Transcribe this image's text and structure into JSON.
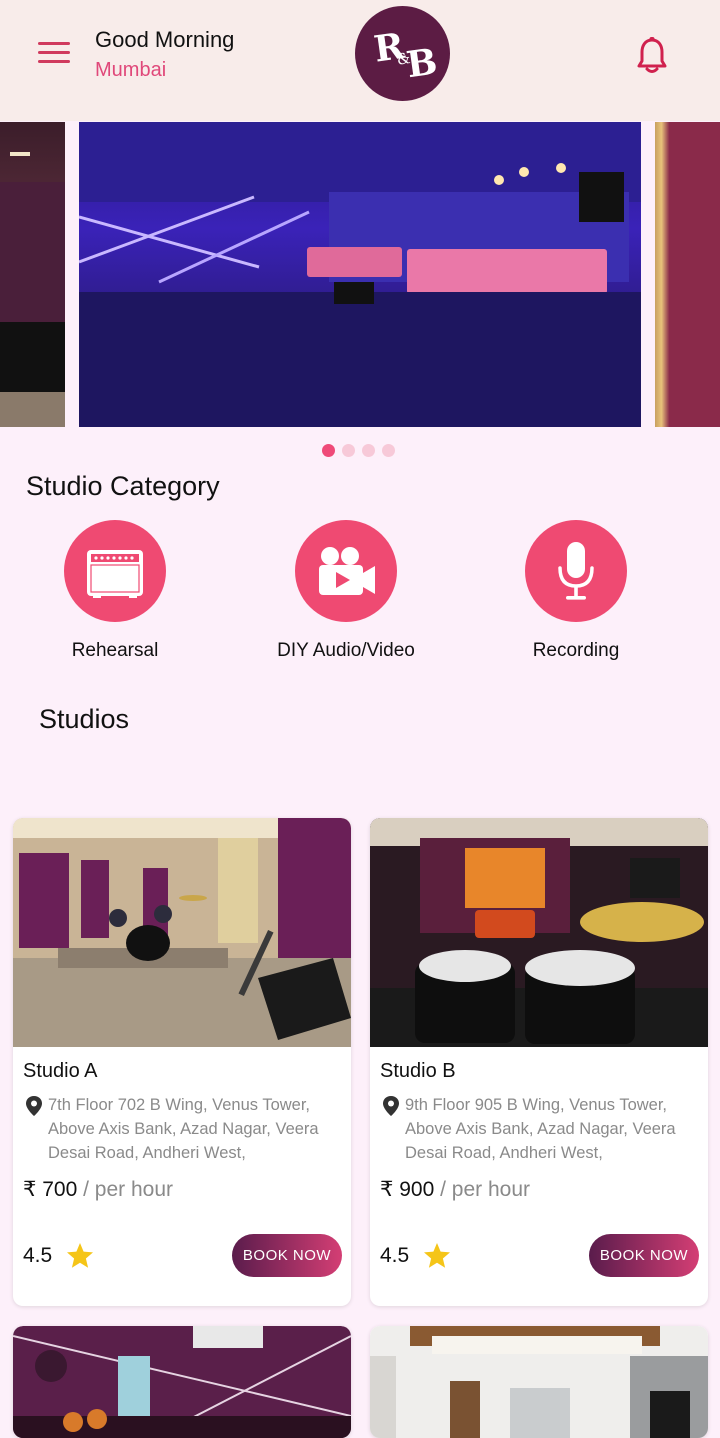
{
  "header": {
    "greeting": "Good Morning",
    "city": "Mumbai",
    "logo_text": "R&B",
    "menu_icon": "hamburger-menu-icon",
    "notification_icon": "bell-icon"
  },
  "carousel": {
    "slide_count": 4,
    "active_index": 0
  },
  "category": {
    "title": "Studio Category",
    "items": [
      {
        "label": "Rehearsal",
        "icon": "amplifier-icon"
      },
      {
        "label": "DIY Audio/Video",
        "icon": "video-camera-icon"
      },
      {
        "label": "Recording",
        "icon": "microphone-icon"
      }
    ]
  },
  "studios": {
    "title": "Studios",
    "items": [
      {
        "name": "Studio A",
        "address": "7th Floor 702 B Wing, Venus Tower, Above Axis Bank, Azad Nagar, Veera Desai Road, Andheri West,",
        "currency": "₹",
        "price": "700",
        "unit": "/ per hour",
        "rating": "4.5",
        "button": "BOOK NOW"
      },
      {
        "name": "Studio B",
        "address": "9th Floor 905 B Wing, Venus Tower, Above Axis Bank, Azad Nagar, Veera Desai Road, Andheri West,",
        "currency": "₹",
        "price": "900",
        "unit": "/ per hour",
        "rating": "4.5",
        "button": "BOOK NOW"
      }
    ]
  },
  "colors": {
    "accent": "#ef4a72",
    "city": "#e0487a",
    "logo_bg": "#5c1c44",
    "button_start": "#5a1c4c",
    "button_end": "#d43e74",
    "header_bg": "#f8ecea",
    "page_bg": "#fdf0fa",
    "star": "#f5c518"
  }
}
